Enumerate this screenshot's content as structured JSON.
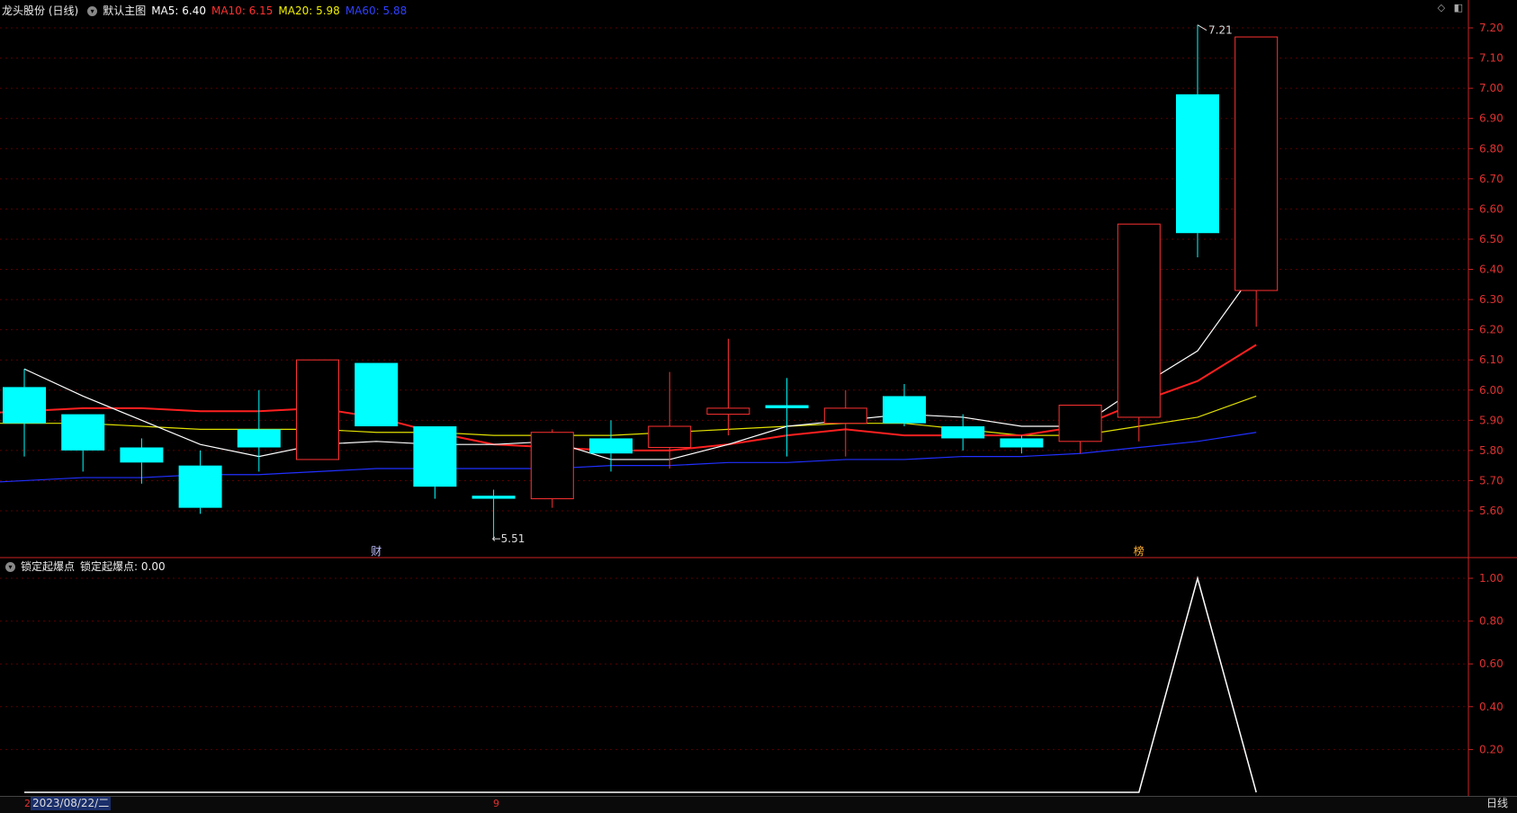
{
  "header": {
    "stock_name": "龙头股份 (日线)",
    "main_chart_name": "默认主图",
    "ma5": "MA5: 6.40",
    "ma10": "MA10: 6.15",
    "ma20": "MA20: 5.98",
    "ma60": "MA60: 5.88"
  },
  "sub_header": {
    "indicator_name": "锁定起爆点",
    "indicator_value": "锁定起爆点: 0.00"
  },
  "bottom": {
    "date": "2023/08/22/二",
    "marker_left": "2",
    "marker_mid": "9",
    "period": "日线"
  },
  "colors": {
    "up": "#ff3232",
    "down": "#00ffff",
    "ma5": "#ffffff",
    "ma10": "#ff2020",
    "ma20": "#e0e000",
    "ma60": "#2030ff",
    "axis": "#cc2222",
    "grid": "#5a0000"
  },
  "chart_data": [
    {
      "type": "candlestick",
      "title": "龙头股份 (日线)",
      "ylim": [
        5.5,
        7.25
      ],
      "yticks": [
        5.6,
        5.7,
        5.8,
        5.9,
        6.0,
        6.1,
        6.2,
        6.3,
        6.4,
        6.5,
        6.6,
        6.7,
        6.8,
        6.9,
        7.0,
        7.1,
        7.2
      ],
      "candles": [
        {
          "o": 6.01,
          "h": 6.07,
          "l": 5.78,
          "c": 5.89
        },
        {
          "o": 5.92,
          "h": 5.92,
          "l": 5.73,
          "c": 5.8
        },
        {
          "o": 5.81,
          "h": 5.84,
          "l": 5.69,
          "c": 5.76
        },
        {
          "o": 5.75,
          "h": 5.8,
          "l": 5.59,
          "c": 5.61
        },
        {
          "o": 5.87,
          "h": 6.0,
          "l": 5.73,
          "c": 5.81
        },
        {
          "o": 5.77,
          "h": 6.1,
          "l": 5.77,
          "c": 6.1
        },
        {
          "o": 6.09,
          "h": 6.09,
          "l": 5.88,
          "c": 5.88
        },
        {
          "o": 5.88,
          "h": 5.88,
          "l": 5.64,
          "c": 5.68
        },
        {
          "o": 5.65,
          "h": 5.67,
          "l": 5.51,
          "c": 5.64
        },
        {
          "o": 5.64,
          "h": 5.87,
          "l": 5.61,
          "c": 5.86
        },
        {
          "o": 5.84,
          "h": 5.9,
          "l": 5.73,
          "c": 5.79
        },
        {
          "o": 5.81,
          "h": 6.06,
          "l": 5.74,
          "c": 5.88
        },
        {
          "o": 5.92,
          "h": 6.17,
          "l": 5.85,
          "c": 5.94
        },
        {
          "o": 5.95,
          "h": 6.04,
          "l": 5.78,
          "c": 5.94
        },
        {
          "o": 5.89,
          "h": 6.0,
          "l": 5.78,
          "c": 5.94
        },
        {
          "o": 5.98,
          "h": 6.02,
          "l": 5.88,
          "c": 5.89
        },
        {
          "o": 5.88,
          "h": 5.92,
          "l": 5.8,
          "c": 5.84
        },
        {
          "o": 5.84,
          "h": 5.85,
          "l": 5.79,
          "c": 5.81
        },
        {
          "o": 5.83,
          "h": 5.95,
          "l": 5.79,
          "c": 5.95
        },
        {
          "o": 5.91,
          "h": 6.55,
          "l": 5.83,
          "c": 6.55
        },
        {
          "o": 6.98,
          "h": 7.21,
          "l": 6.44,
          "c": 6.52
        },
        {
          "o": 6.33,
          "h": 7.17,
          "l": 6.21,
          "c": 7.17
        }
      ],
      "ma5": [
        6.07,
        5.98,
        5.9,
        5.82,
        5.78,
        5.82,
        5.83,
        5.82,
        5.82,
        5.83,
        5.77,
        5.77,
        5.82,
        5.88,
        5.9,
        5.92,
        5.91,
        5.88,
        5.88,
        6.01,
        6.13,
        6.4
      ],
      "ma10": [
        5.92,
        5.93,
        5.94,
        5.94,
        5.93,
        5.93,
        5.94,
        5.91,
        5.86,
        5.82,
        5.81,
        5.8,
        5.8,
        5.82,
        5.85,
        5.87,
        5.85,
        5.85,
        5.85,
        5.88,
        5.96,
        6.03,
        6.15
      ],
      "ma20": [
        5.89,
        5.89,
        5.89,
        5.88,
        5.87,
        5.87,
        5.87,
        5.86,
        5.86,
        5.85,
        5.85,
        5.85,
        5.86,
        5.87,
        5.88,
        5.89,
        5.89,
        5.87,
        5.85,
        5.85,
        5.88,
        5.91,
        5.98
      ],
      "ma60": [
        5.69,
        5.7,
        5.71,
        5.71,
        5.72,
        5.72,
        5.73,
        5.74,
        5.74,
        5.74,
        5.74,
        5.75,
        5.75,
        5.76,
        5.76,
        5.77,
        5.77,
        5.78,
        5.78,
        5.79,
        5.81,
        5.83,
        5.86
      ],
      "annotations": [
        {
          "text": "7.21",
          "candle": 20,
          "price": 7.21
        },
        {
          "text": "5.51",
          "candle": 8,
          "price": 5.51
        },
        {
          "text": "财",
          "candle": 6
        },
        {
          "text": "榜",
          "candle": 19
        }
      ]
    },
    {
      "type": "line",
      "title": "锁定起爆点",
      "ylim": [
        0.0,
        1.05
      ],
      "yticks": [
        0.2,
        0.4,
        0.6,
        0.8,
        1.0
      ],
      "values": [
        0,
        0,
        0,
        0,
        0,
        0,
        0,
        0,
        0,
        0,
        0,
        0,
        0,
        0,
        0,
        0,
        0,
        0,
        0,
        0,
        1,
        0
      ]
    }
  ]
}
